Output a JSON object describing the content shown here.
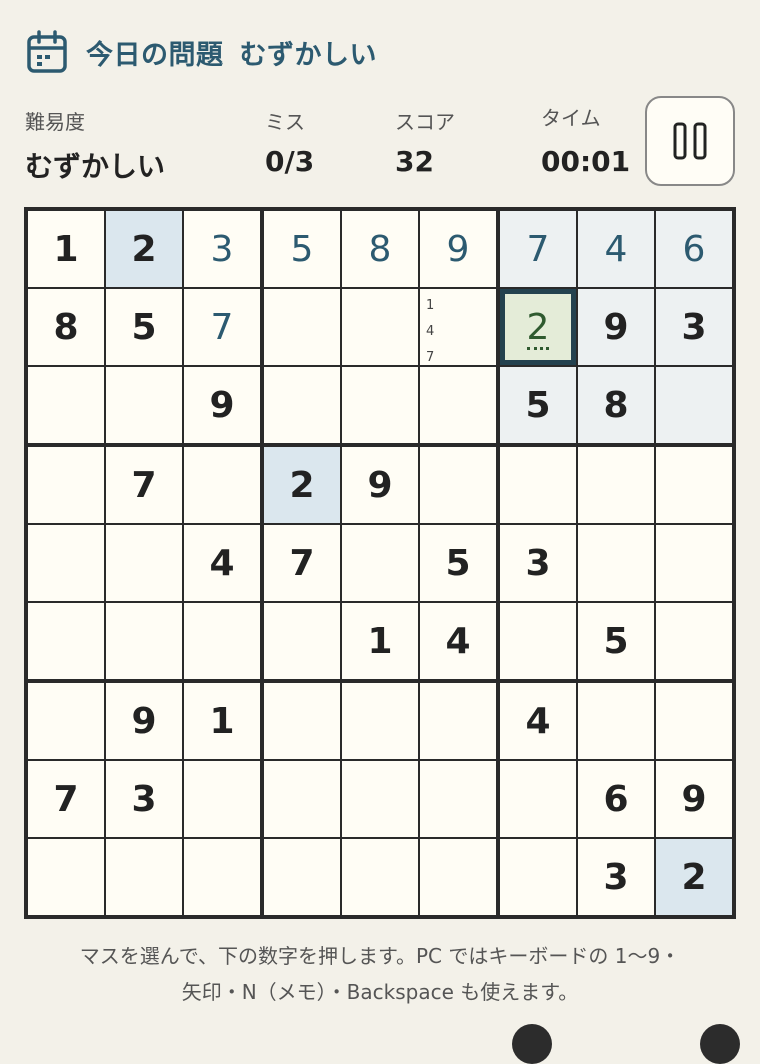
{
  "header": {
    "title_main": "今日の問題",
    "title_level": "むずかしい",
    "icon": "calendar-icon"
  },
  "stats": {
    "difficulty_label": "難易度",
    "difficulty_value": "むずかしい",
    "mistakes_label": "ミス",
    "mistakes_value": "0/3",
    "score_label": "スコア",
    "score_value": "32",
    "time_label": "タイム",
    "time_value": "00:01",
    "pause_icon": "pause-icon"
  },
  "board": {
    "rows": [
      [
        "1",
        "2",
        "3",
        "5",
        "8",
        "9",
        "7",
        "4",
        "6"
      ],
      [
        "8",
        "5",
        "7",
        "",
        "",
        "",
        "2",
        "9",
        "3"
      ],
      [
        "",
        "",
        "9",
        "",
        "",
        "",
        "5",
        "8",
        ""
      ],
      [
        "",
        "7",
        "",
        "2",
        "9",
        "",
        "",
        "",
        ""
      ],
      [
        "",
        "",
        "4",
        "7",
        "",
        "5",
        "3",
        "",
        ""
      ],
      [
        "",
        "",
        "",
        "",
        "1",
        "4",
        "",
        "5",
        ""
      ],
      [
        "",
        "9",
        "1",
        "",
        "",
        "",
        "4",
        "",
        ""
      ],
      [
        "7",
        "3",
        "",
        "",
        "",
        "",
        "",
        "6",
        "9"
      ],
      [
        "",
        "",
        "",
        "",
        "",
        "",
        "",
        "3",
        "2"
      ]
    ],
    "user_cells": [
      [
        0,
        2
      ],
      [
        0,
        3
      ],
      [
        0,
        4
      ],
      [
        0,
        5
      ],
      [
        0,
        6
      ],
      [
        0,
        7
      ],
      [
        0,
        8
      ],
      [
        1,
        2
      ],
      [
        1,
        6
      ]
    ],
    "selected": [
      1,
      6
    ],
    "highlight_cells": [
      [
        0,
        1
      ],
      [
        3,
        3
      ],
      [
        8,
        8
      ]
    ],
    "peer_cells": [
      [
        0,
        6
      ],
      [
        0,
        7
      ],
      [
        0,
        8
      ],
      [
        1,
        7
      ],
      [
        1,
        8
      ],
      [
        2,
        6
      ],
      [
        2,
        7
      ],
      [
        2,
        8
      ]
    ],
    "notes": {
      "cell": [
        1,
        5
      ],
      "values": [
        "1",
        "4",
        "7"
      ]
    }
  },
  "hint": {
    "line1": "マスを選んで、下の数字を押します。PC ではキーボードの 1〜9・",
    "line2": "矢印・N（メモ）・Backspace も使えます。"
  },
  "colors": {
    "accent": "#2c5a70",
    "background": "#f3f1e9",
    "cell_bg": "#fffdf5",
    "highlight": "#dbe7ee",
    "selected_bg": "#e4ecd8"
  }
}
